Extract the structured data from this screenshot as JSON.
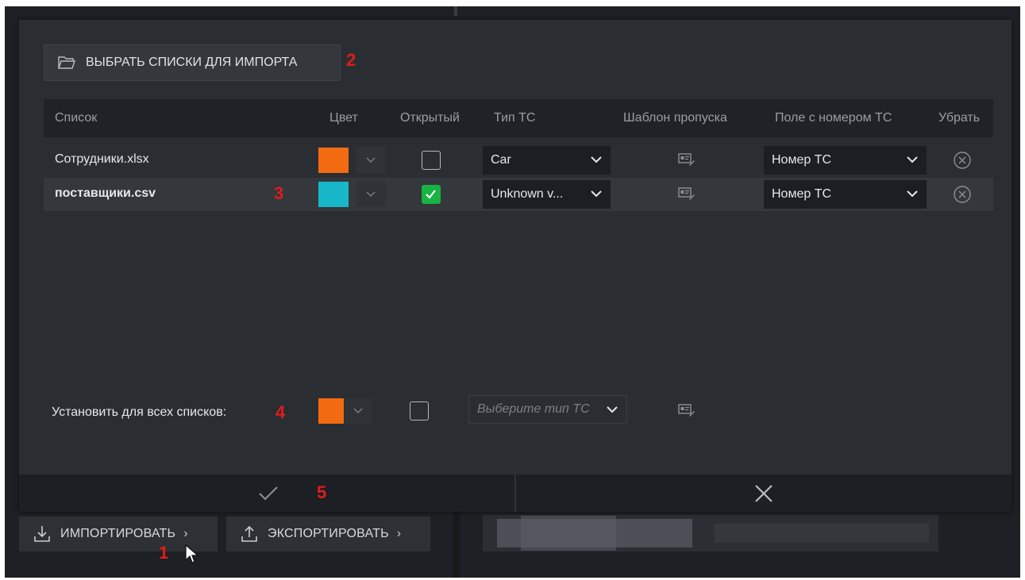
{
  "toolbar": {
    "import_label": "ИМПОРТИРОВАТЬ",
    "export_label": "ЭКСПОРТИРОВАТЬ"
  },
  "dialog": {
    "choose_button_label": "ВЫБРАТЬ СПИСКИ ДЛЯ ИМПОРТА",
    "columns": {
      "list": "Список",
      "color": "Цвет",
      "open": "Открытый",
      "vehicle_type": "Тип ТС",
      "pass_template": "Шаблон пропуска",
      "plate_field": "Поле с номером ТС",
      "remove": "Убрать"
    },
    "rows": [
      {
        "name": "Сотрудники.xlsx",
        "color": "#f26b11",
        "open": false,
        "vehicle_type": "Car",
        "plate_field": "Номер ТС"
      },
      {
        "name": "поставщики.csv",
        "color": "#17b7c9",
        "open": true,
        "vehicle_type": "Unknown v...",
        "plate_field": "Номер ТС"
      }
    ],
    "set_all": {
      "label": "Установить для всех списков:",
      "color": "#f26b11",
      "open": false,
      "vehicle_type_placeholder": "Выберите тип ТС"
    },
    "footer": {
      "confirm_icon": "check-icon",
      "cancel_icon": "close-icon"
    }
  },
  "annotations": [
    "1",
    "2",
    "3",
    "4",
    "5"
  ]
}
